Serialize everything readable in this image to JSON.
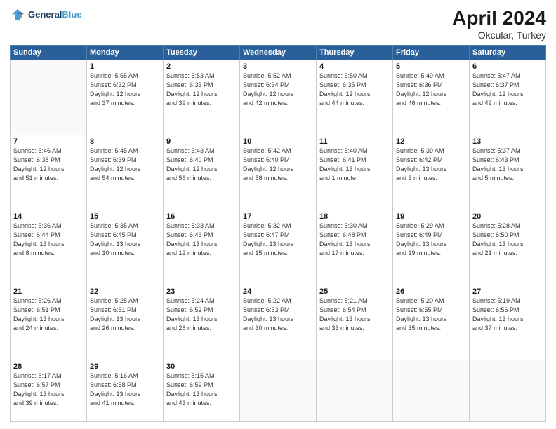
{
  "header": {
    "logo_line1": "General",
    "logo_line2": "Blue",
    "title": "April 2024",
    "subtitle": "Okcular, Turkey"
  },
  "days_of_week": [
    "Sunday",
    "Monday",
    "Tuesday",
    "Wednesday",
    "Thursday",
    "Friday",
    "Saturday"
  ],
  "weeks": [
    [
      {
        "day": "",
        "info": ""
      },
      {
        "day": "1",
        "info": "Sunrise: 5:55 AM\nSunset: 6:32 PM\nDaylight: 12 hours\nand 37 minutes."
      },
      {
        "day": "2",
        "info": "Sunrise: 5:53 AM\nSunset: 6:33 PM\nDaylight: 12 hours\nand 39 minutes."
      },
      {
        "day": "3",
        "info": "Sunrise: 5:52 AM\nSunset: 6:34 PM\nDaylight: 12 hours\nand 42 minutes."
      },
      {
        "day": "4",
        "info": "Sunrise: 5:50 AM\nSunset: 6:35 PM\nDaylight: 12 hours\nand 44 minutes."
      },
      {
        "day": "5",
        "info": "Sunrise: 5:49 AM\nSunset: 6:36 PM\nDaylight: 12 hours\nand 46 minutes."
      },
      {
        "day": "6",
        "info": "Sunrise: 5:47 AM\nSunset: 6:37 PM\nDaylight: 12 hours\nand 49 minutes."
      }
    ],
    [
      {
        "day": "7",
        "info": "Sunrise: 5:46 AM\nSunset: 6:38 PM\nDaylight: 12 hours\nand 51 minutes."
      },
      {
        "day": "8",
        "info": "Sunrise: 5:45 AM\nSunset: 6:39 PM\nDaylight: 12 hours\nand 54 minutes."
      },
      {
        "day": "9",
        "info": "Sunrise: 5:43 AM\nSunset: 6:40 PM\nDaylight: 12 hours\nand 56 minutes."
      },
      {
        "day": "10",
        "info": "Sunrise: 5:42 AM\nSunset: 6:40 PM\nDaylight: 12 hours\nand 58 minutes."
      },
      {
        "day": "11",
        "info": "Sunrise: 5:40 AM\nSunset: 6:41 PM\nDaylight: 13 hours\nand 1 minute."
      },
      {
        "day": "12",
        "info": "Sunrise: 5:39 AM\nSunset: 6:42 PM\nDaylight: 13 hours\nand 3 minutes."
      },
      {
        "day": "13",
        "info": "Sunrise: 5:37 AM\nSunset: 6:43 PM\nDaylight: 13 hours\nand 5 minutes."
      }
    ],
    [
      {
        "day": "14",
        "info": "Sunrise: 5:36 AM\nSunset: 6:44 PM\nDaylight: 13 hours\nand 8 minutes."
      },
      {
        "day": "15",
        "info": "Sunrise: 5:35 AM\nSunset: 6:45 PM\nDaylight: 13 hours\nand 10 minutes."
      },
      {
        "day": "16",
        "info": "Sunrise: 5:33 AM\nSunset: 6:46 PM\nDaylight: 13 hours\nand 12 minutes."
      },
      {
        "day": "17",
        "info": "Sunrise: 5:32 AM\nSunset: 6:47 PM\nDaylight: 13 hours\nand 15 minutes."
      },
      {
        "day": "18",
        "info": "Sunrise: 5:30 AM\nSunset: 6:48 PM\nDaylight: 13 hours\nand 17 minutes."
      },
      {
        "day": "19",
        "info": "Sunrise: 5:29 AM\nSunset: 6:49 PM\nDaylight: 13 hours\nand 19 minutes."
      },
      {
        "day": "20",
        "info": "Sunrise: 5:28 AM\nSunset: 6:50 PM\nDaylight: 13 hours\nand 21 minutes."
      }
    ],
    [
      {
        "day": "21",
        "info": "Sunrise: 5:26 AM\nSunset: 6:51 PM\nDaylight: 13 hours\nand 24 minutes."
      },
      {
        "day": "22",
        "info": "Sunrise: 5:25 AM\nSunset: 6:51 PM\nDaylight: 13 hours\nand 26 minutes."
      },
      {
        "day": "23",
        "info": "Sunrise: 5:24 AM\nSunset: 6:52 PM\nDaylight: 13 hours\nand 28 minutes."
      },
      {
        "day": "24",
        "info": "Sunrise: 5:22 AM\nSunset: 6:53 PM\nDaylight: 13 hours\nand 30 minutes."
      },
      {
        "day": "25",
        "info": "Sunrise: 5:21 AM\nSunset: 6:54 PM\nDaylight: 13 hours\nand 33 minutes."
      },
      {
        "day": "26",
        "info": "Sunrise: 5:20 AM\nSunset: 6:55 PM\nDaylight: 13 hours\nand 35 minutes."
      },
      {
        "day": "27",
        "info": "Sunrise: 5:19 AM\nSunset: 6:56 PM\nDaylight: 13 hours\nand 37 minutes."
      }
    ],
    [
      {
        "day": "28",
        "info": "Sunrise: 5:17 AM\nSunset: 6:57 PM\nDaylight: 13 hours\nand 39 minutes."
      },
      {
        "day": "29",
        "info": "Sunrise: 5:16 AM\nSunset: 6:58 PM\nDaylight: 13 hours\nand 41 minutes."
      },
      {
        "day": "30",
        "info": "Sunrise: 5:15 AM\nSunset: 6:59 PM\nDaylight: 13 hours\nand 43 minutes."
      },
      {
        "day": "",
        "info": ""
      },
      {
        "day": "",
        "info": ""
      },
      {
        "day": "",
        "info": ""
      },
      {
        "day": "",
        "info": ""
      }
    ]
  ]
}
